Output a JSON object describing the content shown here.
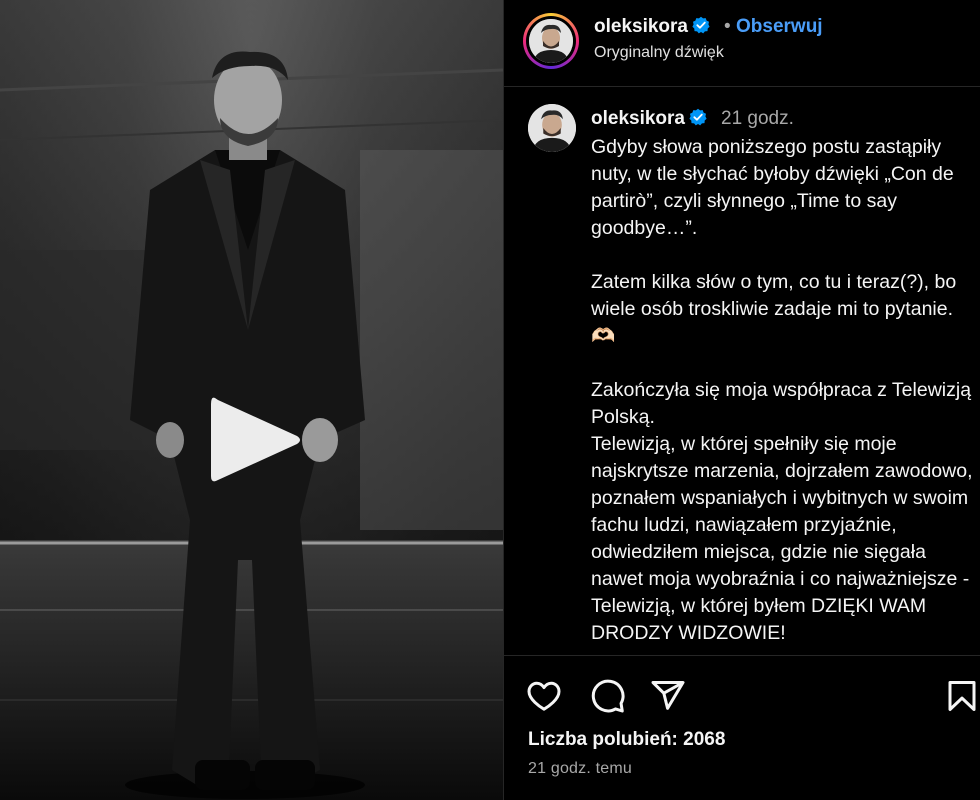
{
  "header": {
    "username": "oleksikora",
    "separator": "•",
    "follow_label": "Obserwuj",
    "audio": "Oryginalny dźwięk"
  },
  "caption": {
    "username": "oleksikora",
    "time": "21 godz.",
    "text": "Gdyby słowa poniższego postu zastąpiły nuty, w tle słychać byłoby dźwięki „Con de partirò”, czyli słynnego „Time to say goodbye…”.\n\nZatem kilka słów o tym, co tu i teraz(?), bo wiele osób troskliwie zadaje mi to pytanie. 🫶🏻\n\nZakończyła się moja współpraca z Telewizją Polską.\nTelewizją, w której spełniły się moje najskrytsze marzenia, dojrzałem zawodowo, poznałem wspaniałych i wybitnych w swoim fachu ludzi, nawiązałem przyjaźnie, odwiedziłem miejsca, gdzie nie sięgała nawet moja wyobraźnia i co najważniejsze - Telewizją, w której byłem DZIĘKI WAM DRODZY WIDZOWIE!"
  },
  "actions": {
    "icons": [
      "heart-icon",
      "comment-icon",
      "share-icon",
      "bookmark-icon"
    ],
    "likes": "Liczba polubień: 2068",
    "posted": "21 godz. temu"
  },
  "colors": {
    "background": "#000000",
    "link": "#4a9df8",
    "verified": "#0095f6",
    "muted": "#a8a8a8"
  }
}
